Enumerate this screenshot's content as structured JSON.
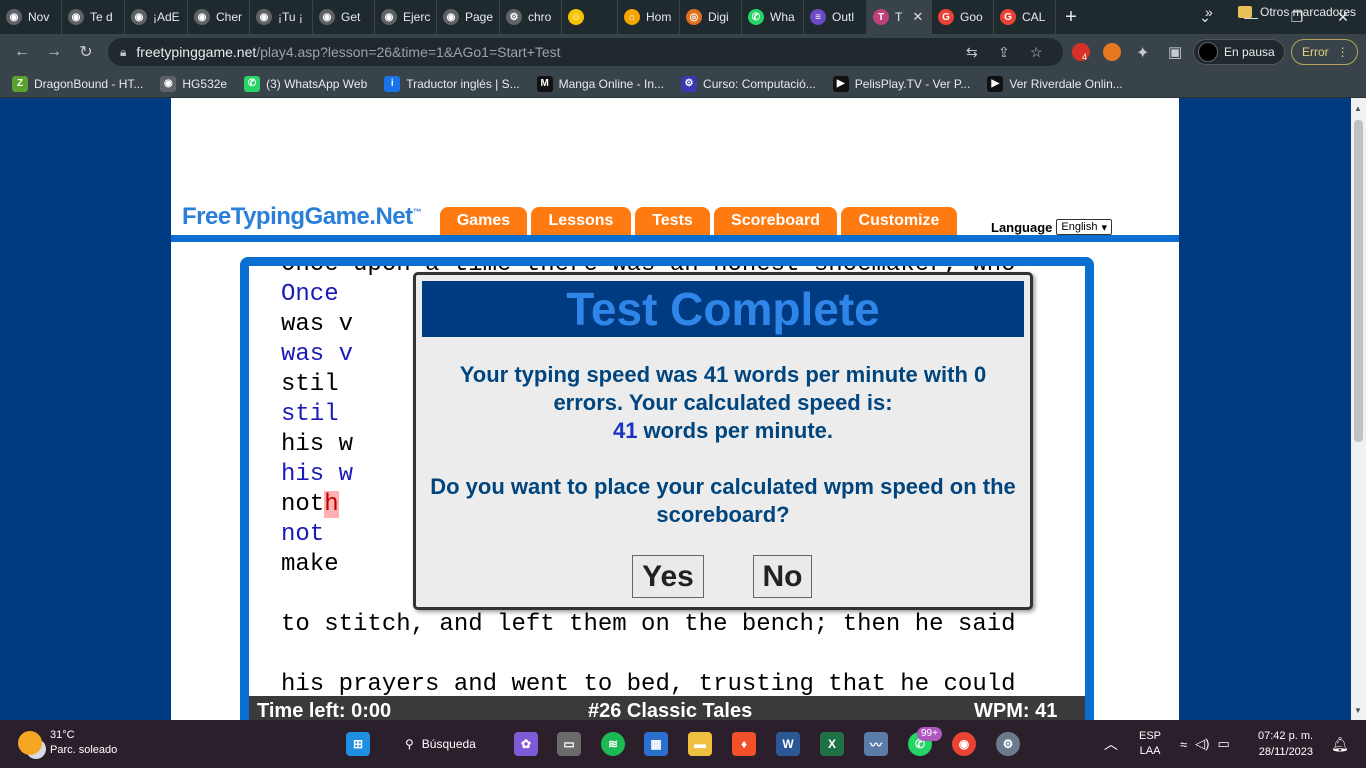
{
  "browser": {
    "tabs": [
      {
        "label": "Nov",
        "icon": "chrome-icon",
        "color": "#5f6368"
      },
      {
        "label": "Te d",
        "icon": "chrome-icon",
        "color": "#5f6368"
      },
      {
        "label": "¡AdE",
        "icon": "chrome-icon",
        "color": "#5f6368"
      },
      {
        "label": "Cher",
        "icon": "chrome-icon",
        "color": "#5f6368"
      },
      {
        "label": "¡Tu ¡",
        "icon": "chrome-icon",
        "color": "#5f6368"
      },
      {
        "label": "Get",
        "icon": "chrome-icon",
        "color": "#5f6368"
      },
      {
        "label": "Ejerc",
        "icon": "chrome-icon",
        "color": "#5f6368"
      },
      {
        "label": "Page",
        "icon": "chrome-icon",
        "color": "#5f6368"
      },
      {
        "label": "chro",
        "icon": "gear-icon",
        "color": "#5f6368"
      },
      {
        "label": "",
        "icon": "emoji-icon",
        "color": "#f5c400"
      },
      {
        "label": "Hom",
        "icon": "home-icon",
        "color": "#f5a400"
      },
      {
        "label": "Digi",
        "icon": "ring-icon",
        "color": "#e07020"
      },
      {
        "label": "Wha",
        "icon": "whatsapp-icon",
        "color": "#25d366"
      },
      {
        "label": "Outl",
        "icon": "list-icon",
        "color": "#6a4bc4"
      },
      {
        "label": "T",
        "icon": "t-icon",
        "color": "#c0407a"
      },
      {
        "label": "Goo",
        "icon": "google-icon",
        "color": "#ea4335"
      },
      {
        "label": "CAL",
        "icon": "google-icon",
        "color": "#ea4335"
      }
    ],
    "active_tab": 14,
    "url_host": "freetypinggame.net",
    "url_path": "/play4.asp?lesson=26&time=1&AGo1=Start+Test",
    "profile_label": "En pausa",
    "error_label": "Error",
    "ext_badge": "4",
    "bookmarks": [
      {
        "label": "DragonBound - HT...",
        "color": "#5aa02c",
        "glyph": "Z"
      },
      {
        "label": "HG532e",
        "color": "#5f6368",
        "glyph": "◉"
      },
      {
        "label": "(3) WhatsApp Web",
        "color": "#25d366",
        "glyph": "✆"
      },
      {
        "label": "Traductor inglés | S...",
        "color": "#1a73e8",
        "glyph": "i"
      },
      {
        "label": "Manga Online - In...",
        "color": "#111111",
        "glyph": "M"
      },
      {
        "label": "Curso: Computació...",
        "color": "#3a3ab0",
        "glyph": "⚙"
      },
      {
        "label": "PelisPlay.TV - Ver P...",
        "color": "#111111",
        "glyph": "▶"
      },
      {
        "label": "Ver Riverdale Onlin...",
        "color": "#111111",
        "glyph": "▶"
      }
    ],
    "bookmarks_more": "»",
    "other_bookmarks": "Otros marcadores"
  },
  "site": {
    "logo": "FreeTypingGame.Net",
    "logo_tm": "™",
    "menu": [
      "Games",
      "Lessons",
      "Tests",
      "Scoreboard",
      "Customize"
    ],
    "language_label": "Language",
    "language_value": "English",
    "colors": {
      "orange": "#ff7a10",
      "blue": "#0a6fd0",
      "navy": "#003a80"
    }
  },
  "game": {
    "lines": [
      {
        "kind": "src",
        "text": "Once upon a time there was an honest shoemaker, who"
      },
      {
        "kind": "typed",
        "text": "Once                                            who"
      },
      {
        "kind": "src",
        "text": "was v                                          nd"
      },
      {
        "kind": "typed",
        "text": "was v                                          nd"
      },
      {
        "kind": "src",
        "text": "stil                                          and"
      },
      {
        "kind": "typed",
        "text": "stil                                          and"
      },
      {
        "kind": "src",
        "text": "his w"
      },
      {
        "kind": "typed",
        "text": "his w"
      },
      {
        "kind": "src_err",
        "pre": "not",
        "err": "h",
        "post": "                                        gh to"
      },
      {
        "kind": "typed",
        "text": "not"
      },
      {
        "kind": "src",
        "text": "make                                         eady"
      },
      {
        "kind": "typed",
        "text": ""
      },
      {
        "kind": "src",
        "text": "to stitch, and left them on the bench; then he said"
      },
      {
        "kind": "typed",
        "text": ""
      },
      {
        "kind": "src",
        "text": "his prayers and went to bed, trusting that he could"
      }
    ],
    "status": {
      "time_left": "Time left: 0:00",
      "lesson": "#26 Classic Tales",
      "wpm": "WPM: 41"
    },
    "modal": {
      "title": "Test Complete",
      "result_line1": "Your typing speed was 41 words per minute with 0",
      "result_line2": "errors. Your calculated speed is:",
      "calc_wpm": "41",
      "calc_unit": " words per minute.",
      "question": "Do you want to place your calculated wpm speed on the scoreboard?",
      "yes_label": "Yes",
      "no_label": "No"
    }
  },
  "taskbar": {
    "temperature": "31°C",
    "weather": "Parc. soleado",
    "search_label": "Búsqueda",
    "whatsapp_badge": "99+",
    "lang_top": "ESP",
    "lang_bottom": "LAA",
    "time": "07:42 p. m.",
    "date": "28/11/2023"
  }
}
